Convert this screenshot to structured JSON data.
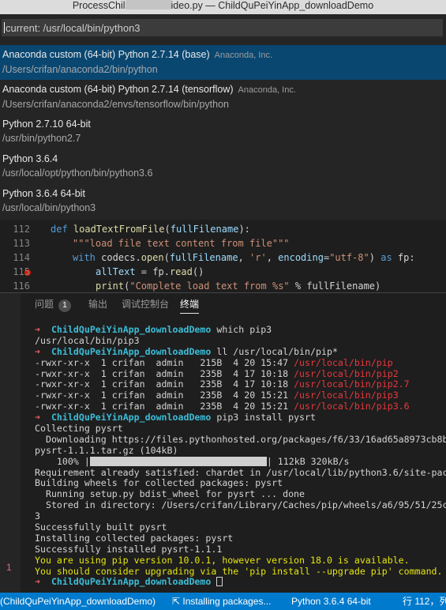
{
  "window": {
    "title_left": "ProcessChil",
    "title_right": "ideo.py — ChildQuPeiYinApp_downloadDemo"
  },
  "picker": {
    "input_text": "current: /usr/local/bin/python3",
    "items": [
      {
        "label": "Anaconda custom (64-bit) Python 2.7.14 (base)",
        "desc": "Anaconda, Inc.",
        "path": "/Users/crifan/anaconda2/bin/python"
      },
      {
        "label": "Anaconda custom (64-bit) Python 2.7.14 (tensorflow)",
        "desc": "Anaconda, Inc.",
        "path": "/Users/crifan/anaconda2/envs/tensorflow/bin/python"
      },
      {
        "label": "Python 2.7.10 64-bit",
        "desc": "",
        "path": "/usr/bin/python2.7"
      },
      {
        "label": "Python 3.6.4",
        "desc": "",
        "path": "/usr/local/opt/python/bin/python3.6"
      },
      {
        "label": "Python 3.6.4 64-bit",
        "desc": "",
        "path": "/usr/local/bin/python3"
      }
    ]
  },
  "editor": {
    "lines": [
      {
        "num": "112",
        "p1": "def ",
        "p2": "loadTextFromFile",
        "p3": "(",
        "p4": "fullFilename",
        "p5": "):"
      },
      {
        "num": "113",
        "p1": "\"\"\"load file text content from file\"\"\""
      },
      {
        "num": "114",
        "p1": "with ",
        "p2": "codecs",
        "p3": ".",
        "p4": "open",
        "p5": "(",
        "p6": "fullFilename",
        "p7": ", ",
        "p8": "'r'",
        "p9": ", ",
        "p10": "encoding",
        "p11": "=",
        "p12": "\"utf-8\"",
        "p13": ") ",
        "p14": "as ",
        "p15": "fp:"
      },
      {
        "num": "115",
        "p1": "allText",
        "p2": " = fp.",
        "p3": "read",
        "p4": "()"
      },
      {
        "num": "116",
        "p1": "print",
        "p2": "(",
        "p3": "\"Complete load text from %s\"",
        "p4": " % fullFilename)"
      }
    ]
  },
  "panel": {
    "tabs": [
      "问题",
      "输出",
      "调试控制台",
      "终端"
    ],
    "problems_count": "1",
    "gutter_number": "1"
  },
  "terminal": {
    "arrow": "➜",
    "dir": "ChildQuPeiYinApp_downloadDemo",
    "cmd1": "which pip3",
    "out1": "/usr/local/bin/pip3",
    "cmd2": "ll /usr/local/bin/pip*",
    "ls_rows": [
      {
        "meta": "-rwxr-xr-x  1 crifan  admin   215B  4 20 15:47 ",
        "path": "/usr/local/bin/pip"
      },
      {
        "meta": "-rwxr-xr-x  1 crifan  admin   235B  4 17 10:18 ",
        "path": "/usr/local/bin/pip2"
      },
      {
        "meta": "-rwxr-xr-x  1 crifan  admin   235B  4 17 10:18 ",
        "path": "/usr/local/bin/pip2.7"
      },
      {
        "meta": "-rwxr-xr-x  1 crifan  admin   235B  4 20 15:21 ",
        "path": "/usr/local/bin/pip3"
      },
      {
        "meta": "-rwxr-xr-x  1 crifan  admin   235B  4 20 15:21 ",
        "path": "/usr/local/bin/pip3.6"
      }
    ],
    "cmd3": "pip3 install pysrt",
    "out_collecting": "Collecting pysrt",
    "out_downloading": "  Downloading https://files.pythonhosted.org/packages/f6/33/16ad65a8973cb8b",
    "out_tar": "pysrt-1.1.1.tar.gz (104kB)",
    "progress_pct": "    100% |",
    "progress_fill": 1.0,
    "progress_tail": "| 112kB 320kB/s",
    "out_req": "Requirement already satisfied: chardet in /usr/local/lib/python3.6/site-pac",
    "out_build": "Building wheels for collected packages: pysrt",
    "out_running": "  Running setup.py bdist_wheel for pysrt ... done",
    "out_stored": "  Stored in directory: /Users/crifan/Library/Caches/pip/wheels/a6/95/51/25c",
    "out_3": "3",
    "out_built": "Successfully built pysrt",
    "out_installing": "Installing collected packages: pysrt",
    "out_installed": "Successfully installed pysrt-1.1.1",
    "warn1": "You are using pip version 10.0.1, however version 18.0 is available.",
    "warn2": "You should consider upgrading via the 'pip install --upgrade pip' command."
  },
  "statusbar": {
    "env": "(ChildQuPeiYinApp_downloadDemo)",
    "installing": "Installing packages...",
    "interpreter": "Python 3.6.4 64-bit",
    "position": "行 112，列"
  },
  "colors": {
    "accent": "#007acc",
    "selection": "#094771",
    "prompt_arrow": "#e95f5f",
    "prompt_dir": "#3dbcd6",
    "warning": "#e5e510"
  }
}
